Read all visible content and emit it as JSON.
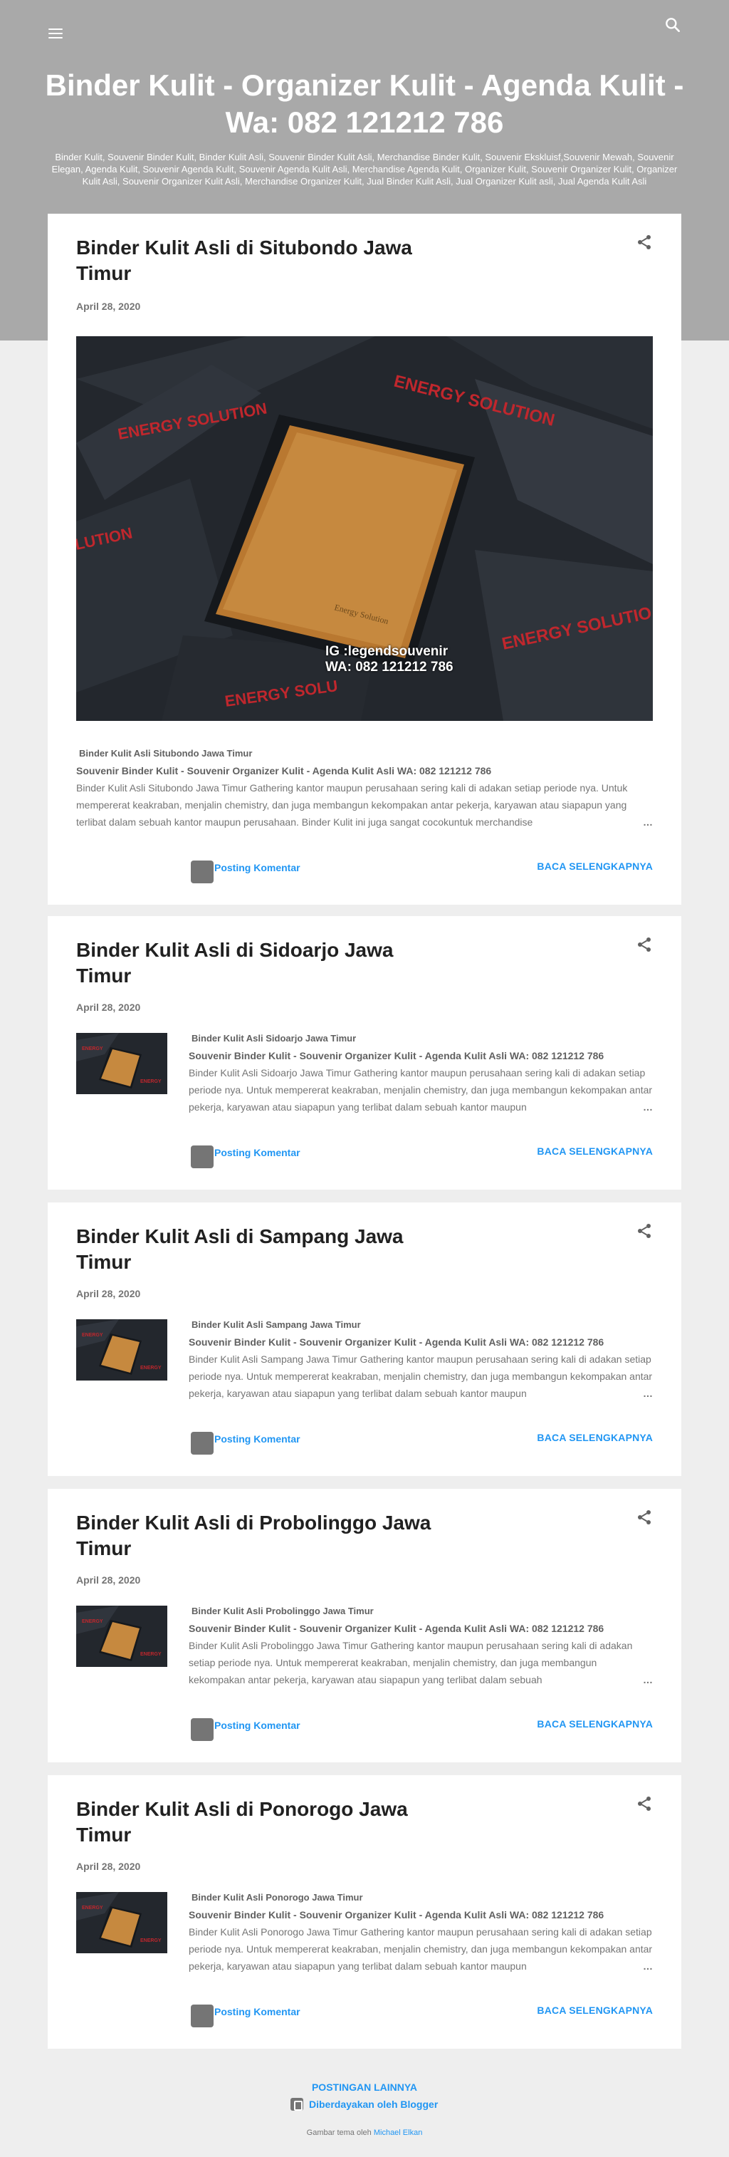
{
  "header": {
    "title": "Binder Kulit - Organizer Kulit - Agenda Kulit - Wa: 082 121212 786",
    "description": "Binder Kulit, Souvenir Binder Kulit, Binder Kulit Asli, Souvenir Binder Kulit Asli, Merchandise Binder Kulit, Souvenir Ekskluisf,Souvenir Mewah, Souvenir Elegan, Agenda Kulit, Souvenir Agenda Kulit, Souvenir Agenda Kulit Asli, Merchandise Agenda Kulit, Organizer Kulit, Souvenir Organizer Kulit, Organizer Kulit Asli, Souvenir Organizer Kulit Asli, Merchandise Organizer Kulit, Jual Binder Kulit Asli, Jual Organizer Kulit asli, Jual Agenda Kulit Asli",
    "menu_icon": "hamburger-menu-icon",
    "search_icon": "search-icon"
  },
  "posts": [
    {
      "title": "Binder Kulit Asli di Situbondo Jawa Timur",
      "date": "April 28, 2020",
      "image_text_1": "IG  :legendsouvenir",
      "image_text_2": "WA: 082 121212 786",
      "snippet_title": "Binder Kulit Asli Situbondo Jawa Timur",
      "snippet_sub": "Souvenir Binder Kulit - Souvenir Organizer Kulit - Agenda Kulit Asli  WA: 082 121212 786",
      "snippet_body": "Binder Kulit Asli Situbondo Jawa Timur Gathering kantor maupun perusahaan sering kali di adakan setiap periode nya. Untuk mempererat keakraban, menjalin chemistry, dan juga membangun kekompakan antar pekerja, karyawan atau siapapun yang terlibat dalam sebuah kantor maupun perusahaan. Binder Kulit ini juga sangat cocokuntuk merchandise",
      "comment_label": "Posting Komentar",
      "read_more": "BACA SELENGKAPNYA"
    },
    {
      "title": "Binder Kulit Asli di Sidoarjo Jawa Timur",
      "date": "April 28, 2020",
      "snippet_title": "Binder Kulit Asli Sidoarjo Jawa Timur",
      "snippet_sub": "Souvenir Binder Kulit - Souvenir Organizer Kulit - Agenda Kulit Asli  WA: 082 121212 786",
      "snippet_body": "Binder Kulit Asli Sidoarjo Jawa Timur Gathering kantor maupun perusahaan sering kali di adakan setiap periode nya. Untuk mempererat keakraban, menjalin chemistry, dan juga membangun kekompakan antar pekerja, karyawan atau siapapun yang terlibat dalam sebuah kantor maupun",
      "comment_label": "Posting Komentar",
      "read_more": "BACA SELENGKAPNYA"
    },
    {
      "title": "Binder Kulit Asli di Sampang Jawa Timur",
      "date": "April 28, 2020",
      "snippet_title": "Binder Kulit Asli Sampang Jawa Timur",
      "snippet_sub": "Souvenir Binder Kulit - Souvenir Organizer Kulit - Agenda Kulit Asli  WA: 082 121212 786",
      "snippet_body": "Binder Kulit Asli Sampang Jawa Timur Gathering kantor maupun perusahaan sering kali di adakan setiap periode nya. Untuk mempererat keakraban, menjalin chemistry, dan juga membangun kekompakan antar pekerja, karyawan atau siapapun yang terlibat dalam sebuah kantor maupun",
      "comment_label": "Posting Komentar",
      "read_more": "BACA SELENGKAPNYA"
    },
    {
      "title": "Binder Kulit Asli di Probolinggo Jawa Timur",
      "date": "April 28, 2020",
      "snippet_title": "Binder Kulit Asli Probolinggo Jawa Timur",
      "snippet_sub": "Souvenir Binder Kulit - Souvenir Organizer Kulit - Agenda Kulit Asli  WA: 082 121212 786",
      "snippet_body": "Binder Kulit Asli Probolinggo Jawa Timur Gathering kantor maupun perusahaan sering kali di adakan setiap periode nya. Untuk mempererat keakraban, menjalin chemistry, dan juga membangun kekompakan antar pekerja, karyawan atau siapapun yang terlibat dalam sebuah",
      "comment_label": "Posting Komentar",
      "read_more": "BACA SELENGKAPNYA"
    },
    {
      "title": "Binder Kulit Asli di Ponorogo Jawa Timur",
      "date": "April 28, 2020",
      "snippet_title": "Binder Kulit Asli Ponorogo Jawa Timur",
      "snippet_sub": "Souvenir Binder Kulit - Souvenir Organizer Kulit - Agenda Kulit Asli  WA: 082 121212 786",
      "snippet_body": "Binder Kulit Asli Ponorogo Jawa Timur Gathering kantor maupun perusahaan sering kali di adakan setiap periode nya. Untuk mempererat keakraban, menjalin chemistry, dan juga membangun kekompakan antar pekerja, karyawan atau siapapun yang terlibat dalam sebuah kantor maupun",
      "comment_label": "Posting Komentar",
      "read_more": "BACA SELENGKAPNYA"
    }
  ],
  "footer": {
    "older_posts": "POSTINGAN LAINNYA",
    "powered_by": "Diberdayakan oleh Blogger",
    "theme_prefix": "Gambar tema oleh",
    "theme_author": "Michael Elkan"
  },
  "colors": {
    "header_bg": "#a9a9a9",
    "link": "#2196f3",
    "page_bg": "#eeeeee"
  }
}
